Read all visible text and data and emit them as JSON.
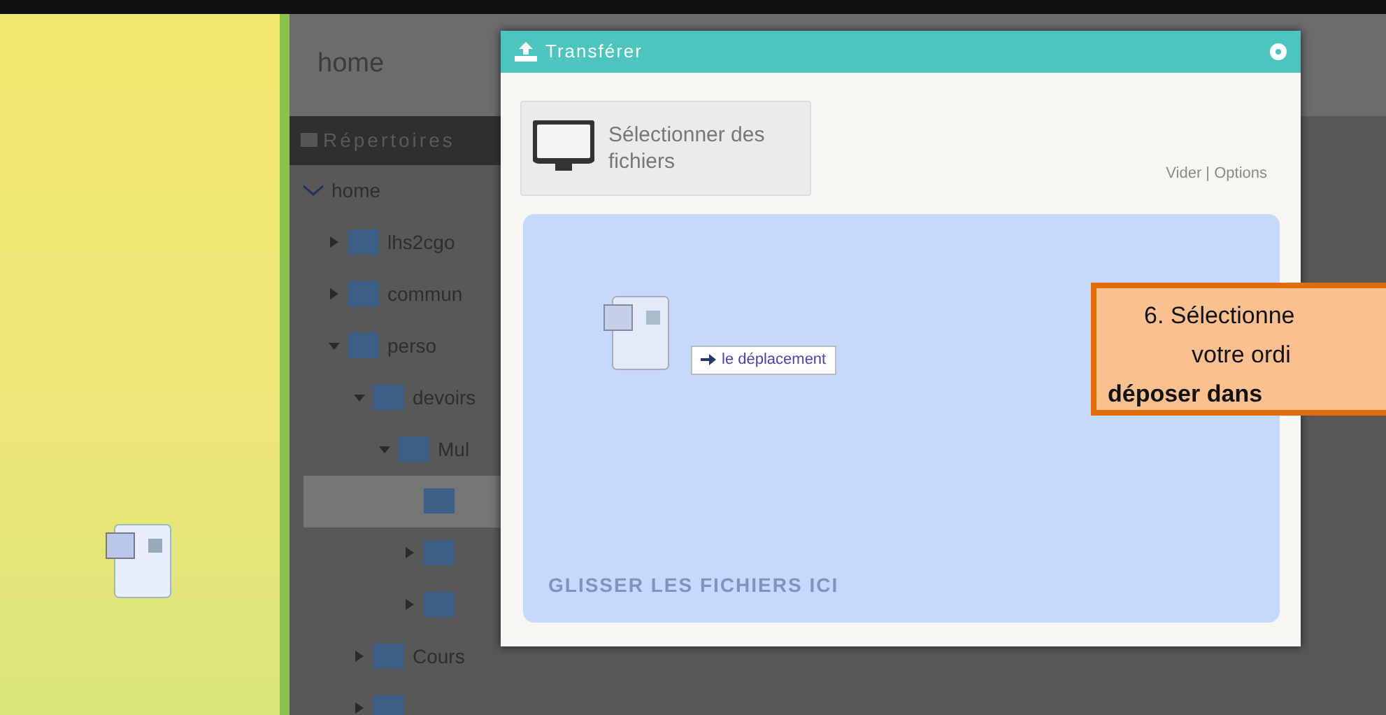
{
  "app": {
    "breadcrumb": "home",
    "panel_title": "Répertoires",
    "tree": [
      {
        "label": "home",
        "expanded": true,
        "selected": false,
        "children": [
          {
            "label": "lhs2cgo",
            "expanded": false,
            "selected": false
          },
          {
            "label": "commun",
            "expanded": false,
            "selected": false
          },
          {
            "label": "perso",
            "expanded": true,
            "selected": false,
            "children": [
              {
                "label": "devoirs",
                "expanded": true,
                "selected": false,
                "children": [
                  {
                    "label": "Mul",
                    "expanded": true,
                    "selected": false,
                    "children": [
                      {
                        "selected": true
                      },
                      {
                        "expanded": false,
                        "selected": false
                      },
                      {
                        "expanded": false,
                        "selected": false
                      }
                    ]
                  }
                ]
              },
              {
                "label": "Cours",
                "expanded": false,
                "selected": false
              },
              {
                "expanded": false,
                "selected": false
              }
            ]
          }
        ]
      }
    ]
  },
  "dialog": {
    "title": "Transférer",
    "select_button": "Sélectionner des fichiers",
    "options": "Vider | Options",
    "drag_tooltip": "le déplacement",
    "drop_hint": "GLISSER LES FICHIERS ICI"
  },
  "callout": {
    "lines": [
      "6. Sélectionne",
      "votre ordi",
      "**déposer dans**"
    ]
  }
}
